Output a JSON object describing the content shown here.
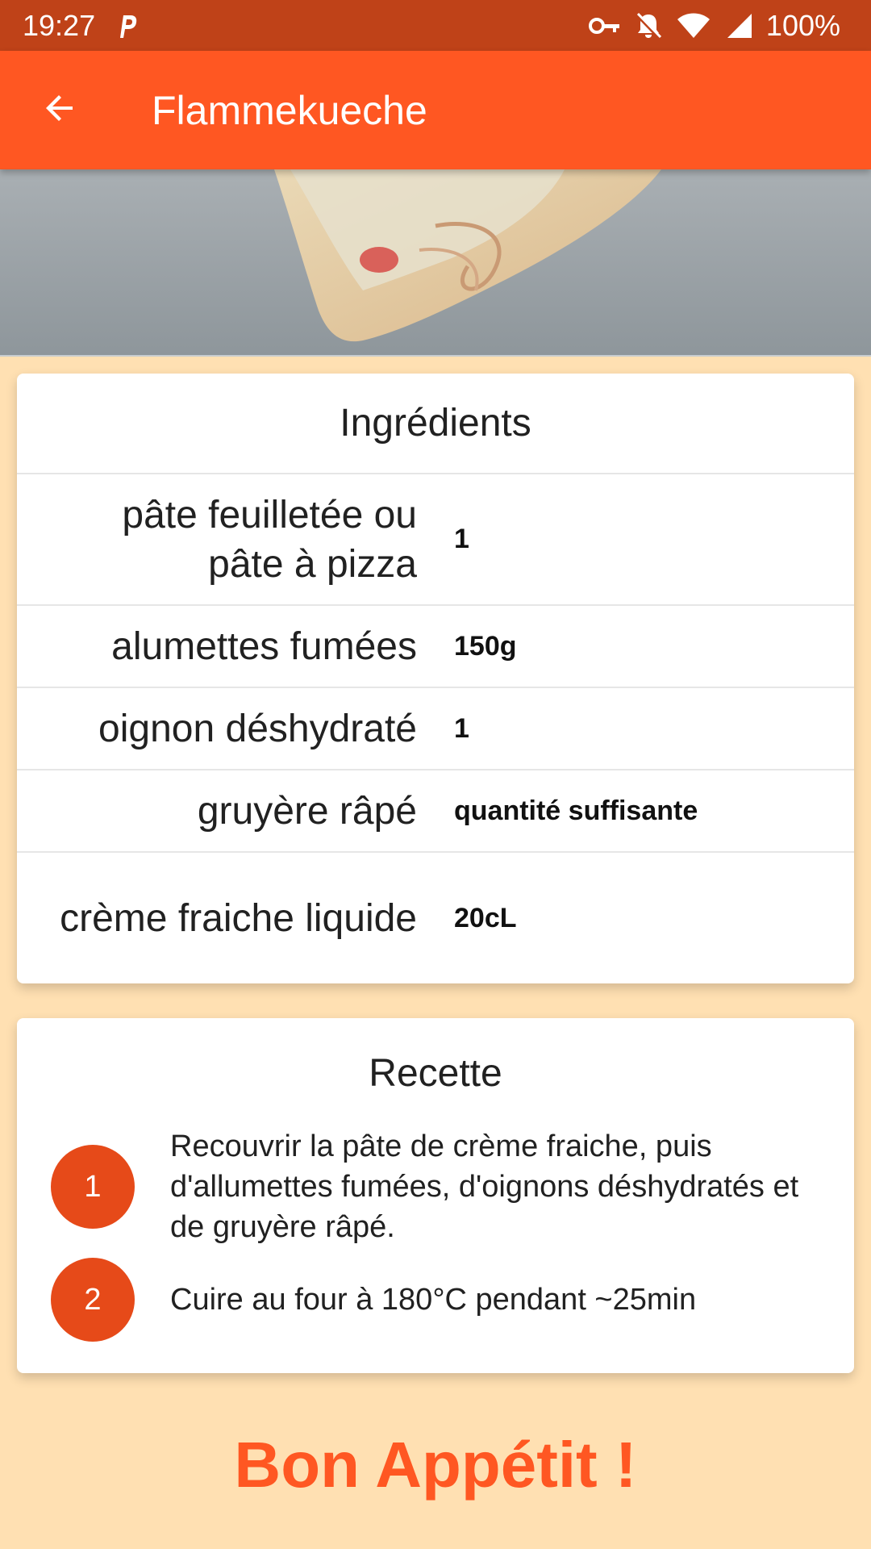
{
  "status_bar": {
    "time": "19:27",
    "battery": "100%"
  },
  "app_bar": {
    "title": "Flammekueche"
  },
  "ingredients": {
    "title": "Ingrédients",
    "items": [
      {
        "name": "pâte feuilletée ou pâte à pizza",
        "qty": "1"
      },
      {
        "name": "alumettes fumées",
        "qty": "150g"
      },
      {
        "name": "oignon déshydraté",
        "qty": "1"
      },
      {
        "name": "gruyère râpé",
        "qty": "quantité suffisante"
      },
      {
        "name": "crème fraiche liquide",
        "qty": "20cL"
      }
    ]
  },
  "recipe": {
    "title": "Recette",
    "steps": [
      {
        "number": "1",
        "text": "Recouvrir la pâte de crème fraiche, puis d'allumettes fumées, d'oignons déshydratés et de gruyère râpé."
      },
      {
        "number": "2",
        "text": "Cuire au four à 180°C pendant ~25min"
      }
    ]
  },
  "footer": {
    "message": "Bon Appétit !"
  },
  "colors": {
    "status_bar": "#BF4218",
    "app_bar": "#FF5722",
    "background": "#FFE0B2",
    "step_circle": "#E64A19"
  }
}
